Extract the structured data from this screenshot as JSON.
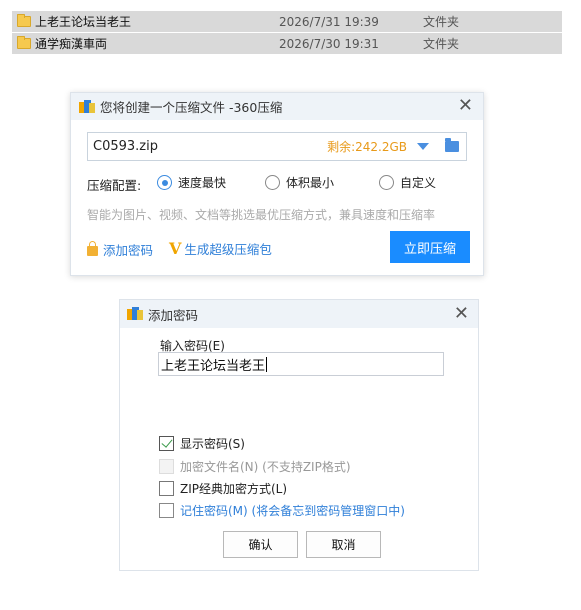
{
  "files": [
    {
      "name": "上老王论坛当老王",
      "date": "2026/7/31 19:39",
      "type": "文件夹"
    },
    {
      "name": "通学痴漢車両",
      "date": "2026/7/30 19:31",
      "type": "文件夹"
    }
  ],
  "compress_dialog": {
    "title": "您将创建一个压缩文件 -360压缩",
    "filename": "C0593.zip",
    "free_space": "剩余:242.2GB",
    "config_label": "压缩配置:",
    "options": [
      "速度最快",
      "体积最小",
      "自定义"
    ],
    "selected_option": "速度最快",
    "hint": "智能为图片、视频、文档等挑选最优压缩方式，兼具速度和压缩率",
    "add_password": "添加密码",
    "super_zip": "生成超级压缩包",
    "compress_now": "立即压缩"
  },
  "password_dialog": {
    "title": "添加密码",
    "input_label": "输入密码(E)",
    "password_value": "上老王论坛当老王",
    "checkboxes": [
      {
        "label": "显示密码(S)",
        "checked": true,
        "disabled": false
      },
      {
        "label": "加密文件名(N) (不支持ZIP格式)",
        "checked": false,
        "disabled": true
      },
      {
        "label": "ZIP经典加密方式(L)",
        "checked": false,
        "disabled": false
      },
      {
        "label": "记住密码(M) (将会备忘到密码管理窗口中)",
        "checked": false,
        "disabled": false
      }
    ],
    "ok_label": "确认",
    "cancel_label": "取消"
  },
  "colors": {
    "accent": "#1a8cff",
    "free_space": "#e89a1a",
    "link": "#2f7fd8"
  }
}
